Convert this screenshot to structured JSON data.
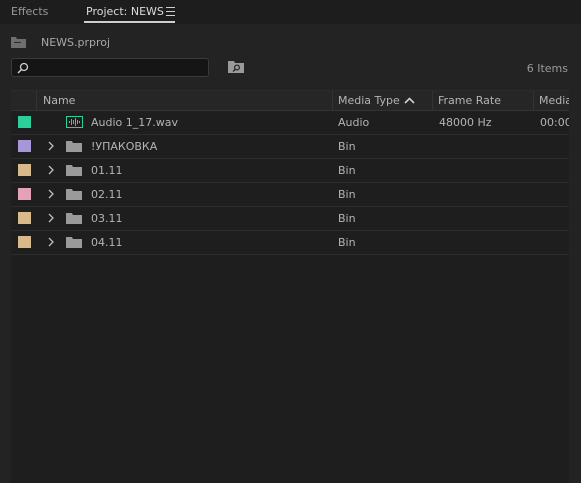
{
  "tabs": [
    {
      "label": "Effects",
      "active": false
    },
    {
      "label": "Project: NEWS",
      "active": true
    }
  ],
  "project": {
    "file_name": "NEWS.prproj",
    "items_count": "6 Items"
  },
  "search": {
    "placeholder": ""
  },
  "columns": {
    "name": "Name",
    "media_type": "Media Type",
    "frame_rate": "Frame Rate",
    "media": "Media"
  },
  "sort": {
    "column": "media_type",
    "direction": "ascending"
  },
  "rows": [
    {
      "name": "Audio 1_17.wav",
      "type": "Audio",
      "frame_rate": "48000 Hz",
      "media": "00:00",
      "kind": "audio",
      "label_color": "#2ccf9a"
    },
    {
      "name": "!УПАКОВКА",
      "type": "Bin",
      "frame_rate": "",
      "media": "",
      "kind": "bin",
      "label_color": "#a897d8"
    },
    {
      "name": "01.11",
      "type": "Bin",
      "frame_rate": "",
      "media": "",
      "kind": "bin",
      "label_color": "#d8b98a"
    },
    {
      "name": "02.11",
      "type": "Bin",
      "frame_rate": "",
      "media": "",
      "kind": "bin",
      "label_color": "#e3a2b8"
    },
    {
      "name": "03.11",
      "type": "Bin",
      "frame_rate": "",
      "media": "",
      "kind": "bin",
      "label_color": "#d8b98a"
    },
    {
      "name": "04.11",
      "type": "Bin",
      "frame_rate": "",
      "media": "",
      "kind": "bin",
      "label_color": "#d8b98a"
    }
  ],
  "colors": {
    "panel_bg": "#232323",
    "table_bg": "#1e1e1e",
    "audio_icon": "#2ccf9a",
    "folder_icon": "#9a9a9a"
  }
}
